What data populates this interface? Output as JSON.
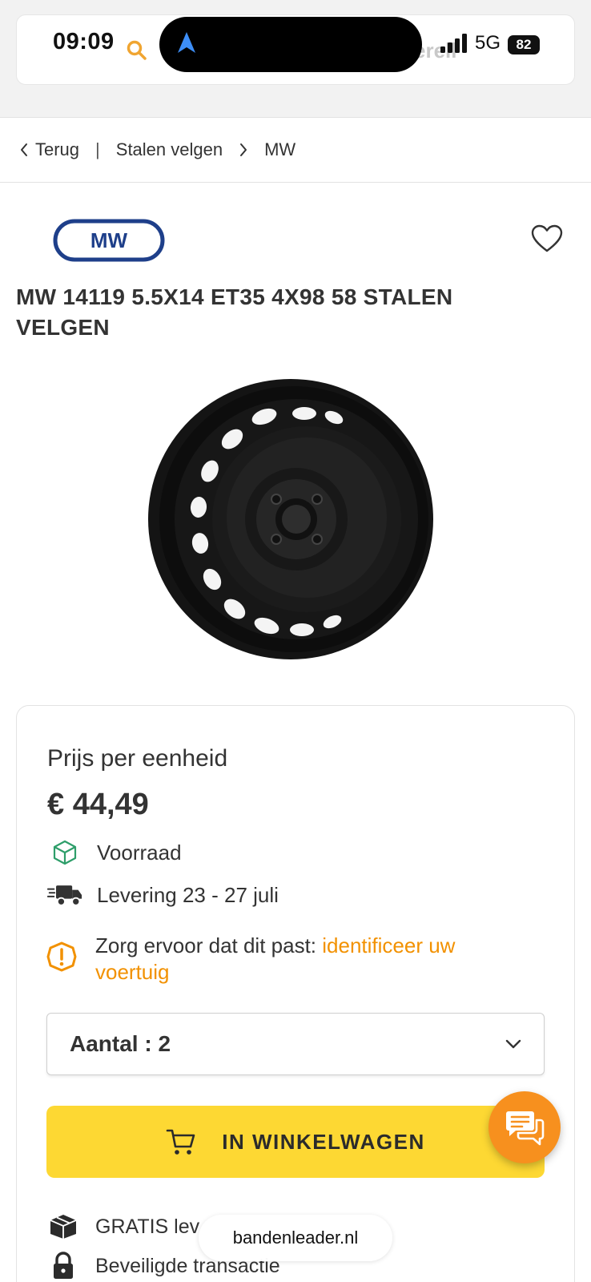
{
  "status_bar": {
    "time": "09:09",
    "network": "5G",
    "battery": "82",
    "hidden_text": "erell"
  },
  "breadcrumb": {
    "back_label": "Terug",
    "separator": "|",
    "items": [
      "Stalen velgen",
      "MW"
    ]
  },
  "product": {
    "brand_logo_text": "MW",
    "title": "MW 14119 5.5X14 ET35 4X98 58 STALEN VELGEN"
  },
  "offer": {
    "price_label": "Prijs per eenheid",
    "price": "€ 44,49",
    "stock": "Voorraad",
    "delivery": "Levering 23 - 27 juli",
    "fit_warning": "Zorg ervoor dat dit past: ",
    "fit_link": "identificeer uw voertuig",
    "quantity_label": "Aantal : 2",
    "quantity": 2,
    "cart_button": "IN WINKELWAGEN"
  },
  "features": [
    {
      "icon": "package-icon",
      "label": "GRATIS lev"
    },
    {
      "icon": "lock-icon",
      "label": "Beveiligde transactie"
    }
  ],
  "browser": {
    "url": "bandenleader.nl"
  },
  "colors": {
    "accent_yellow": "#fdd833",
    "accent_orange": "#f7901e",
    "link_orange": "#f29100",
    "stock_green": "#2e9e6a",
    "brand_blue": "#1e3f8a"
  }
}
